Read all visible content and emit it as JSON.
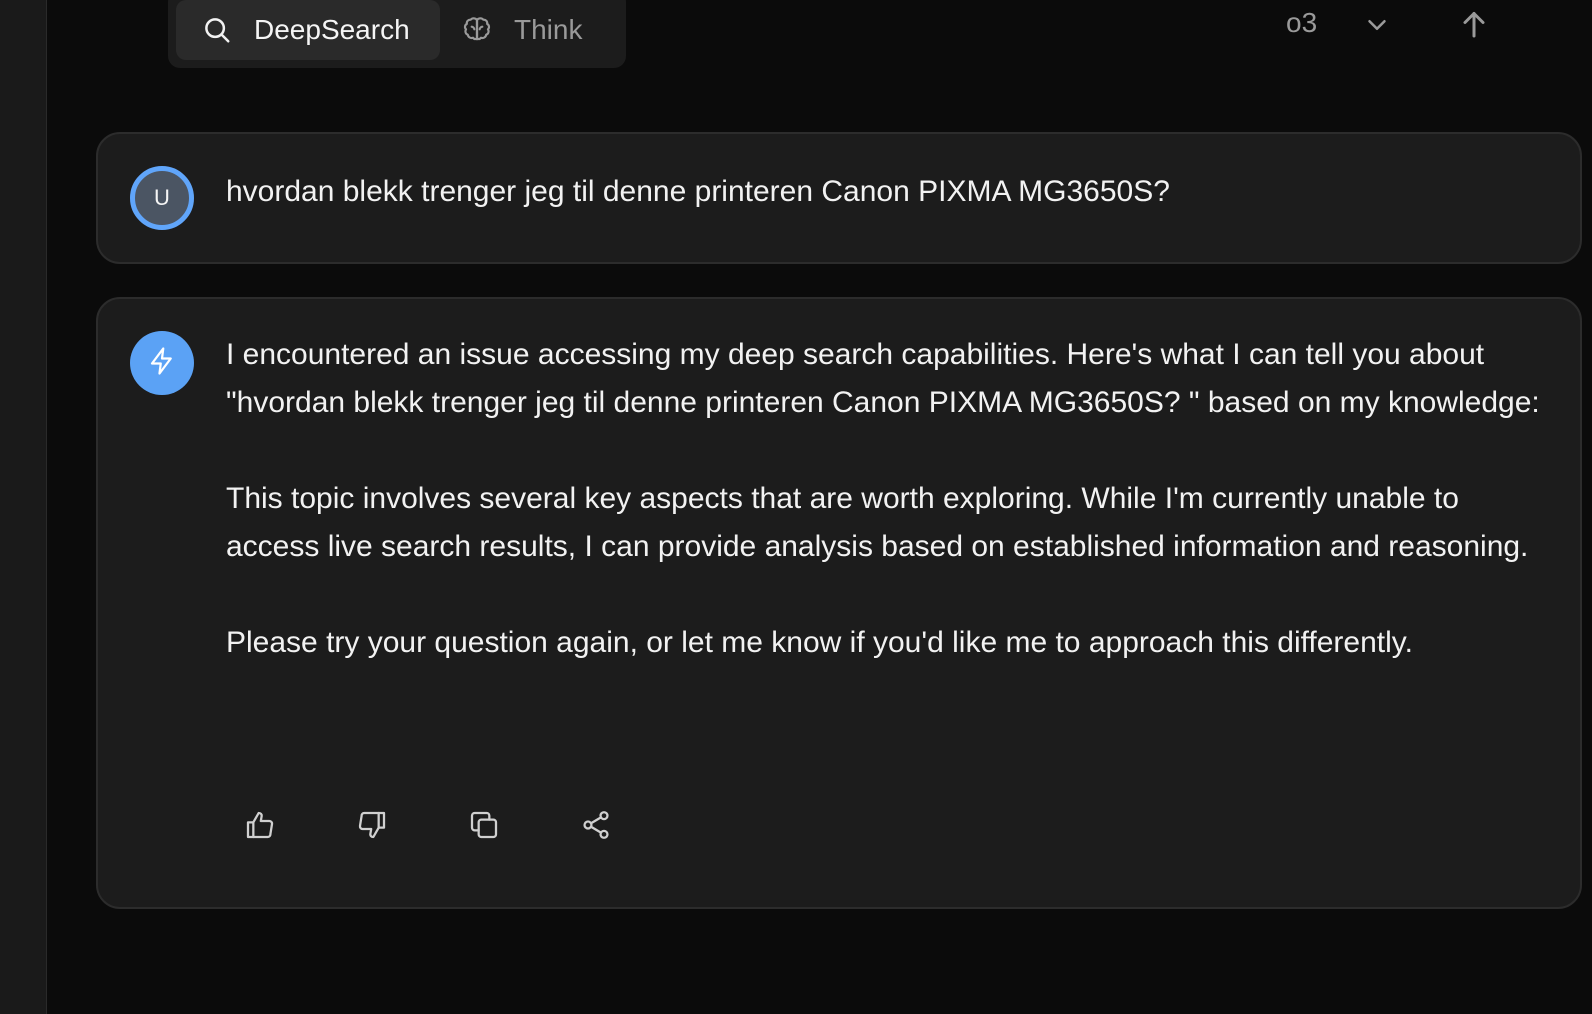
{
  "toolbar": {
    "deepsearch_label": "DeepSearch",
    "think_label": "Think",
    "model_label": "o3"
  },
  "conversation": {
    "user_message": {
      "avatar_initial": "U",
      "text": "hvordan blekk trenger jeg til denne printeren Canon PIXMA MG3650S?"
    },
    "assistant_message": {
      "paragraphs": [
        "I encountered an issue accessing my deep search capabilities. Here's what I can tell you about \"hvordan blekk trenger jeg til denne printeren Canon PIXMA MG3650S? \" based on my knowledge:",
        "This topic involves several key aspects that are worth exploring. While I'm currently unable to access live search results, I can provide analysis based on established information and reasoning.",
        "Please try your question again, or let me know if you'd like me to approach this differently."
      ]
    }
  },
  "icons": {
    "deepsearch": "search-icon",
    "think": "brain-icon",
    "model_dropdown": "chevron-down-icon",
    "send": "arrow-up-icon",
    "assistant_avatar": "lightning-icon",
    "actions": [
      "thumbs-up-icon",
      "thumbs-down-icon",
      "copy-icon",
      "share-icon"
    ]
  },
  "colors": {
    "background": "#0b0b0b",
    "card": "#1c1c1c",
    "accent": "#5ba2f5",
    "muted_text": "#9a9a9a"
  }
}
